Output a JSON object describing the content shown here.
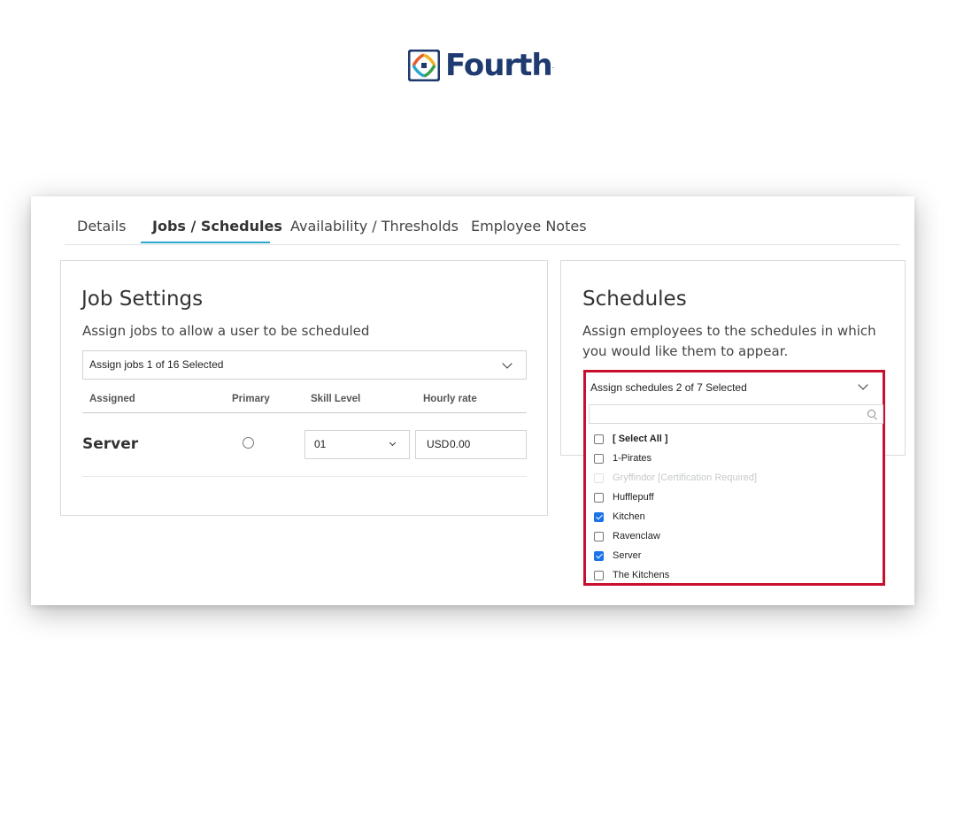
{
  "brand": {
    "name": "Fourth",
    "mark": "."
  },
  "tabs": [
    {
      "label": "Details"
    },
    {
      "label": "Jobs / Schedules",
      "active": true
    },
    {
      "label": "Availability / Thresholds"
    },
    {
      "label": "Employee Notes"
    }
  ],
  "job_settings": {
    "title": "Job Settings",
    "subtitle": "Assign jobs to allow a user to be scheduled",
    "assign_select": "Assign jobs 1 of 16 Selected",
    "columns": {
      "assigned": "Assigned",
      "primary": "Primary",
      "skill_level": "Skill Level",
      "hourly_rate": "Hourly rate"
    },
    "rows": [
      {
        "job": "Server",
        "primary": false,
        "skill_level": "01",
        "currency": "USD",
        "rate": "0.00"
      }
    ]
  },
  "schedules": {
    "title": "Schedules",
    "subtitle": "Assign employees to the schedules in which you would like them to appear.",
    "assign_select": "Assign schedules 2 of 7 Selected",
    "search_placeholder": "",
    "options": [
      {
        "label": "[ Select All ]",
        "checked": false,
        "disabled": false,
        "bold": true
      },
      {
        "label": "1-Pirates",
        "checked": false,
        "disabled": false
      },
      {
        "label": "Gryffindor [Certification Required]",
        "checked": false,
        "disabled": true
      },
      {
        "label": "Hufflepuff",
        "checked": false,
        "disabled": false
      },
      {
        "label": "Kitchen",
        "checked": true,
        "disabled": false
      },
      {
        "label": "Ravenclaw",
        "checked": false,
        "disabled": false
      },
      {
        "label": "Server",
        "checked": true,
        "disabled": false
      },
      {
        "label": "The Kitchens",
        "checked": false,
        "disabled": false
      }
    ]
  },
  "colors": {
    "accent": "#2aa6c9",
    "highlight": "#c8102e",
    "checkbox": "#1a73e8",
    "brand": "#1e3a70"
  }
}
